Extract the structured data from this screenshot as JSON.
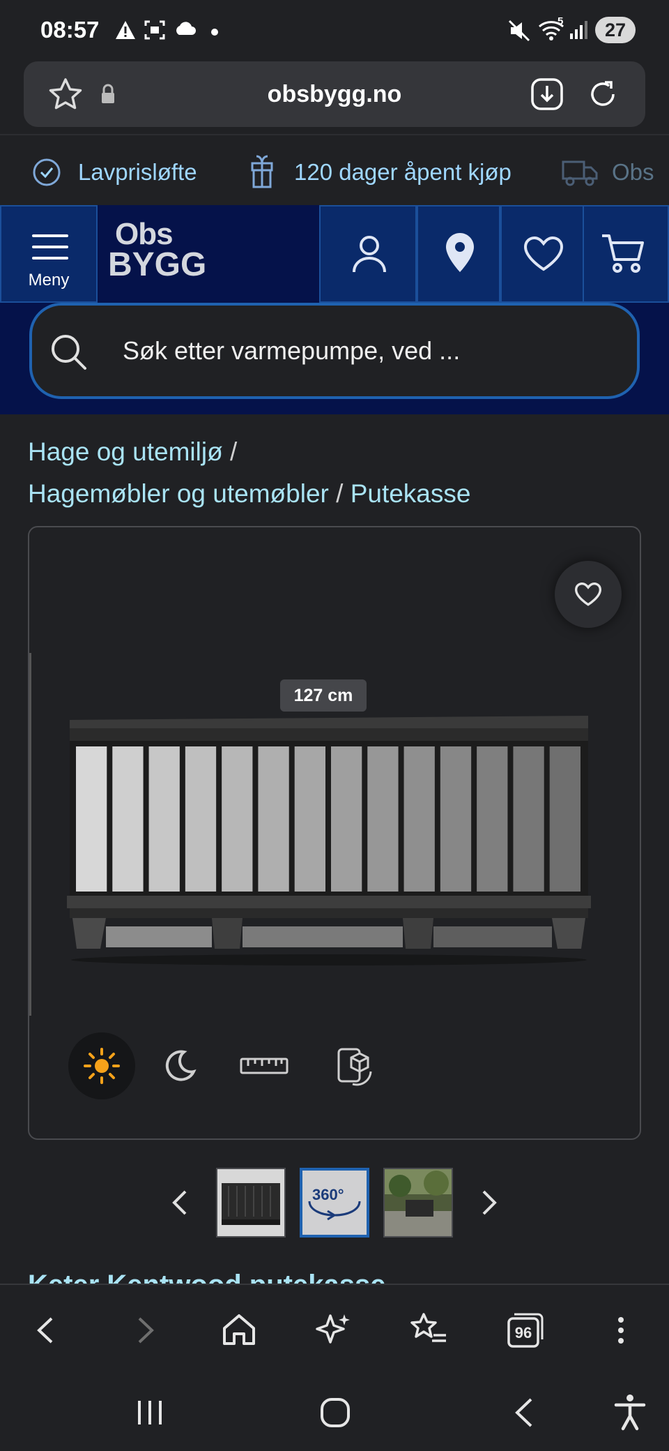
{
  "status_bar": {
    "time": "08:57",
    "battery": "27",
    "wifi_label": "5"
  },
  "browser": {
    "url": "obsbygg.no",
    "tab_count": "96"
  },
  "usp": [
    {
      "label": "Lavprisløfte",
      "icon": "check-circle-icon"
    },
    {
      "label": "120 dager åpent kjøp",
      "icon": "gift-icon"
    },
    {
      "label": "Obs",
      "icon": "truck-icon"
    }
  ],
  "nav": {
    "menu_label": "Meny",
    "logo_line1": "Obs",
    "logo_line2": "BYGG"
  },
  "search": {
    "placeholder": "Søk etter varmepumpe, ved ..."
  },
  "breadcrumb": {
    "item1": "Hage og utemiljø",
    "item2": "Hagemøbler og utemøbler",
    "item3": "Putekasse",
    "separator": "/"
  },
  "viewer": {
    "dimension_label": "127 cm",
    "tools": [
      "sun-icon",
      "moon-icon",
      "ruler-icon",
      "ar-view-icon"
    ],
    "active_tool": "sun-icon",
    "active_color": "#f6a21a"
  },
  "thumbnails": {
    "badge_360": "360°",
    "selected_index": 1
  },
  "product": {
    "title": "Keter Kentwood putekasse"
  },
  "colors": {
    "accent": "#1f62b0",
    "link": "#a9e3f4",
    "nav_bg": "#05124a"
  }
}
